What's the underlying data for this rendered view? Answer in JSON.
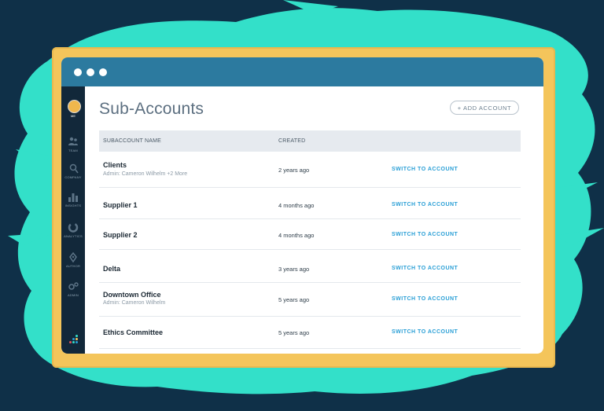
{
  "colors": {
    "background": "#0f3048",
    "splash": "#33e0c9",
    "frame": "#f4c55b",
    "titlebar": "#2c7a9f",
    "sidebar": "#12283a",
    "link": "#2a9fd6"
  },
  "sidebar": {
    "items": [
      {
        "label": "ME",
        "icon": "avatar"
      },
      {
        "label": "TEAM",
        "icon": "team-icon"
      },
      {
        "label": "COMPANY",
        "icon": "company-icon"
      },
      {
        "label": "INSIGHTS",
        "icon": "insights-icon"
      },
      {
        "label": "ANALYTICS",
        "icon": "analytics-icon"
      },
      {
        "label": "AUTHOR",
        "icon": "author-icon"
      },
      {
        "label": "ADMIN",
        "icon": "admin-icon"
      }
    ]
  },
  "page": {
    "title": "Sub-Accounts",
    "add_button": "+ ADD ACCOUNT"
  },
  "table": {
    "headers": [
      "SUBACCOUNT NAME",
      "CREATED"
    ],
    "rows": [
      {
        "name": "Clients",
        "sub": "Admin: Cameron Wilhelm +2 More",
        "created": "2 years ago",
        "action": "SWITCH TO ACCOUNT"
      },
      {
        "name": "Supplier 1",
        "sub": "",
        "created": "4 months ago",
        "action": "SWITCH TO ACCOUNT"
      },
      {
        "name": "Supplier 2",
        "sub": "",
        "created": "4 months ago",
        "action": "SWITCH TO ACCOUNT"
      },
      {
        "name": "Delta",
        "sub": "",
        "created": "3 years ago",
        "action": "SWITCH TO ACCOUNT"
      },
      {
        "name": "Downtown Office",
        "sub": "Admin: Cameron Wilhelm",
        "created": "5 years ago",
        "action": "SWITCH TO ACCOUNT"
      },
      {
        "name": "Ethics Committee",
        "sub": "",
        "created": "5 years ago",
        "action": "SWITCH TO ACCOUNT"
      }
    ]
  }
}
